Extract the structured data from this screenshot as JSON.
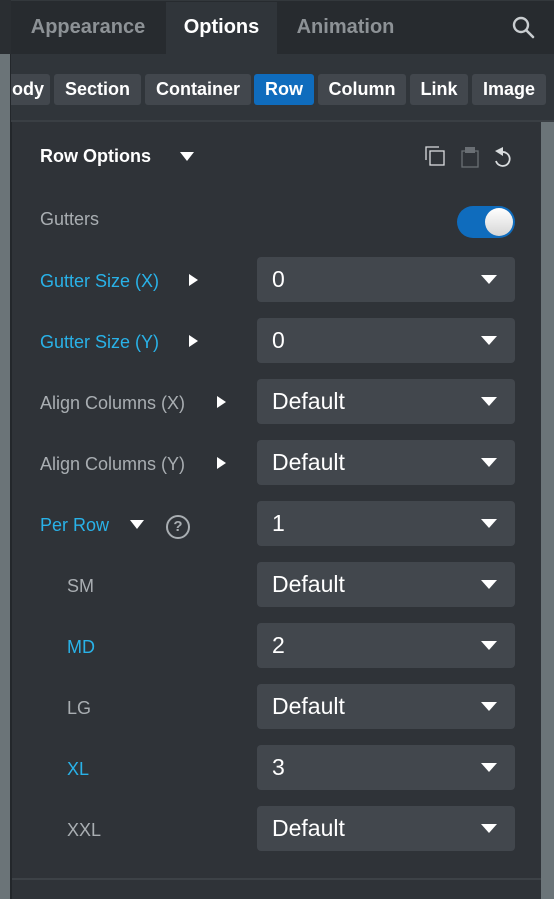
{
  "tabs": [
    {
      "label": "Appearance",
      "active": false
    },
    {
      "label": "Options",
      "active": true
    },
    {
      "label": "Animation",
      "active": false
    }
  ],
  "search_icon": "search-icon",
  "breadcrumbs": [
    {
      "label": "Body",
      "visible_text": "ody",
      "active": false
    },
    {
      "label": "Section",
      "active": false
    },
    {
      "label": "Container",
      "active": false
    },
    {
      "label": "Row",
      "active": true
    },
    {
      "label": "Column",
      "active": false
    },
    {
      "label": "Link",
      "active": false
    },
    {
      "label": "Image",
      "active": false
    }
  ],
  "section": {
    "title": "Row Options",
    "tools": [
      {
        "name": "copy-icon"
      },
      {
        "name": "paste-icon"
      },
      {
        "name": "reset-icon"
      }
    ]
  },
  "fields": {
    "gutters": {
      "label": "Gutters",
      "enabled": true
    },
    "gutter_x": {
      "label": "Gutter Size (X)",
      "value": "0"
    },
    "gutter_y": {
      "label": "Gutter Size (Y)",
      "value": "0"
    },
    "align_x": {
      "label": "Align Columns (X)",
      "value": "Default"
    },
    "align_y": {
      "label": "Align Columns (Y)",
      "value": "Default"
    },
    "per_row": {
      "label": "Per Row",
      "value": "1",
      "help": "?"
    },
    "sm": {
      "label": "SM",
      "value": "Default"
    },
    "md": {
      "label": "MD",
      "value": "2"
    },
    "lg": {
      "label": "LG",
      "value": "Default"
    },
    "xl": {
      "label": "XL",
      "value": "3"
    },
    "xxl": {
      "label": "XXL",
      "value": "Default"
    }
  },
  "colors": {
    "accent": "#0f6cbd",
    "modified_label": "#29b2e8",
    "panel_bg": "#2f3338",
    "select_bg": "#42474d"
  }
}
